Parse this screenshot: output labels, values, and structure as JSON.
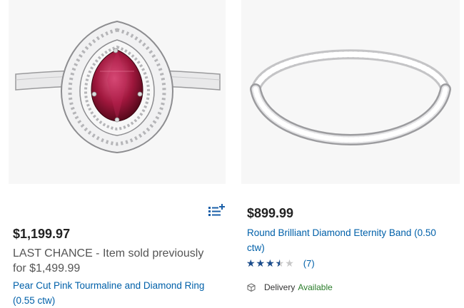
{
  "products": [
    {
      "image": "pink-tourmaline-halo-ring",
      "price": "$1,199.97",
      "promo_label": "LAST CHANCE - Item sold previously",
      "promo_prefix": "for",
      "previous_price": "$1,499.99",
      "title": "Pear Cut Pink Tourmaline and Diamond Ring (0.55 ctw)",
      "compare_icon": "compare-list-icon",
      "compare_color": "#1a5fa8"
    },
    {
      "image": "diamond-eternity-band",
      "price": "$899.99",
      "title": "Round Brilliant Diamond Eternity Band (0.50 ctw)",
      "rating_value": 3.5,
      "rating_max": 5,
      "review_count": "(7)",
      "delivery_label": "Delivery",
      "delivery_status": "Available",
      "delivery_icon": "package-box-icon"
    }
  ],
  "colors": {
    "link": "#0060a9",
    "star": "#1a4c8c",
    "available": "#2a7d2a"
  }
}
